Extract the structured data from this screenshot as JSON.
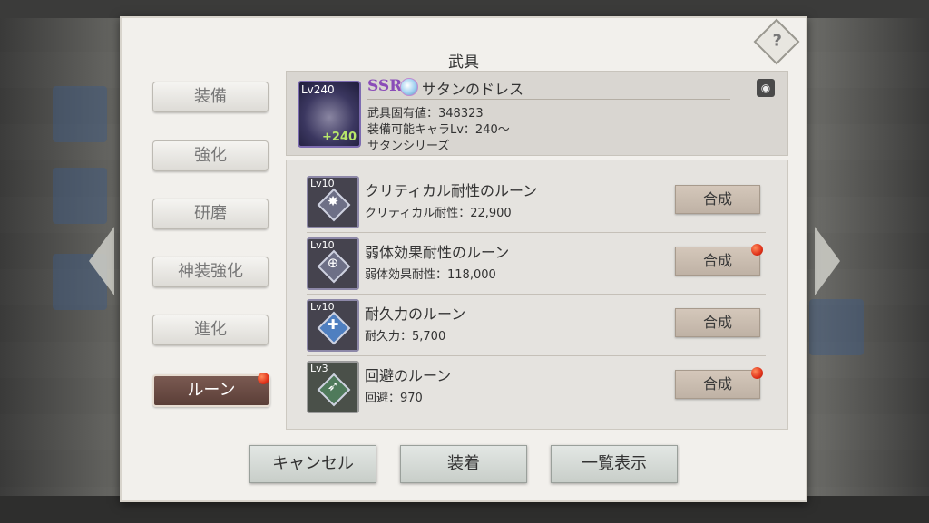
{
  "dialog": {
    "title": "武具",
    "help_label": "?"
  },
  "tabs": [
    {
      "label": "装備"
    },
    {
      "label": "強化"
    },
    {
      "label": "研磨"
    },
    {
      "label": "神装強化"
    },
    {
      "label": "進化"
    },
    {
      "label": "ルーン"
    }
  ],
  "item": {
    "level": "Lv240",
    "plus": "+240",
    "rarity": "SSR",
    "name": "サタンのドレス",
    "stat_line": "武具固有値：348323",
    "equip_line": "装備可能キャラLv：240〜",
    "series_line": "サタンシリーズ"
  },
  "runes": [
    {
      "level": "Lv10",
      "name": "クリティカル耐性のルーン",
      "stat": "クリティカル耐性：22,900",
      "button": "合成"
    },
    {
      "level": "Lv10",
      "name": "弱体効果耐性のルーン",
      "stat": "弱体効果耐性：118,000",
      "button": "合成"
    },
    {
      "level": "Lv10",
      "name": "耐久力のルーン",
      "stat": "耐久力：5,700",
      "button": "合成"
    },
    {
      "level": "Lv3",
      "name": "回避のルーン",
      "stat": "回避：970",
      "button": "合成"
    }
  ],
  "buttons": {
    "cancel": "キャンセル",
    "equip": "装着",
    "list_view": "一覧表示"
  },
  "colors": {
    "badge": "#e0321a",
    "active_tab": "#5b3e37",
    "ssr": "#8a4cb8"
  },
  "icons": {
    "help": "help-icon",
    "rune": "rune-icon",
    "item": "dress-icon"
  }
}
